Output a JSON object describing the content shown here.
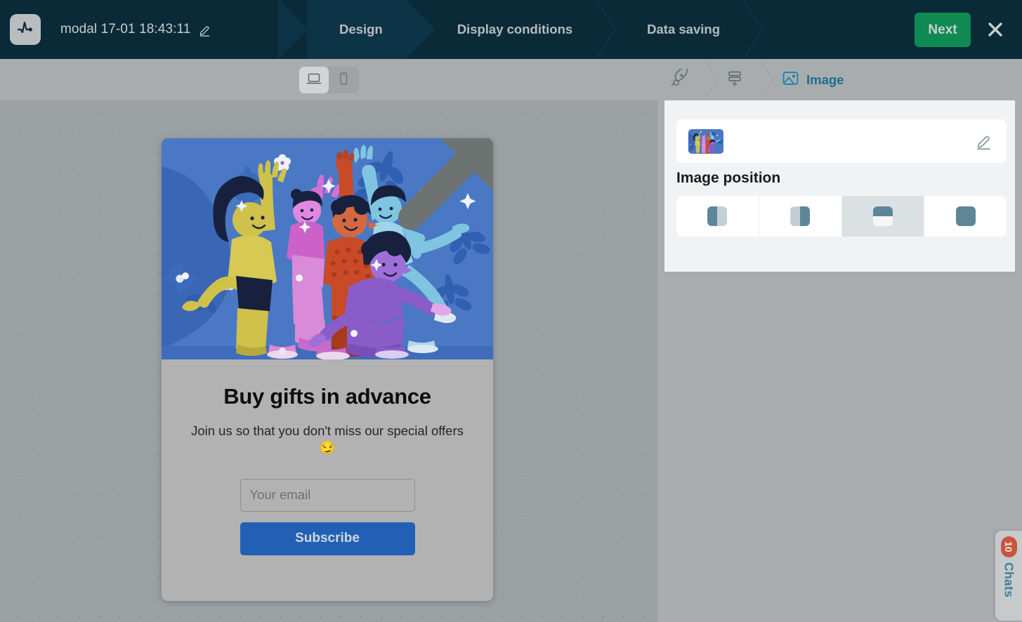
{
  "app": {
    "logo_icon": "pulse-icon",
    "document_title": "modal 17-01 18:43:11",
    "title_edit_icon": "pencil-icon",
    "close_icon": "close-x-icon"
  },
  "steps": [
    {
      "label": "Design",
      "active": true
    },
    {
      "label": "Display conditions",
      "active": false
    },
    {
      "label": "Data saving",
      "active": false
    }
  ],
  "topbar": {
    "next_label": "Next",
    "next_color": "#0f8a53"
  },
  "toolbar": {
    "devices": [
      {
        "name": "desktop-view",
        "icon": "desktop-icon",
        "selected": true
      },
      {
        "name": "mobile-view",
        "icon": "mobile-icon",
        "selected": false
      }
    ]
  },
  "canvas": {
    "background_color": "#9ba0a3",
    "dot_color": "#8c9396"
  },
  "modal_preview": {
    "close_icon": "close-circle-icon",
    "image_alt": "illustration-people-raising-hands",
    "heading": "Buy gifts in advance",
    "subtitle": "Join us so that you don't miss our special offers 😏",
    "email_placeholder": "Your email",
    "email_value": "",
    "subscribe_label": "Subscribe",
    "subscribe_color": "#2160b4"
  },
  "panel": {
    "breadcrumb": [
      {
        "label": "",
        "icon": "rocket-icon",
        "active": false
      },
      {
        "label": "",
        "icon": "blocks-add-icon",
        "active": false
      },
      {
        "label": "Image",
        "icon": "image-icon",
        "active": true
      }
    ],
    "accent_color": "#1d6f8e",
    "image_field": {
      "thumbnail_alt": "illustration-thumbnail",
      "edit_icon": "pencil-icon"
    },
    "position_section_label": "Image position",
    "positions": [
      {
        "name": "image-position-left",
        "icon": "position-left-icon",
        "selected": false
      },
      {
        "name": "image-position-right",
        "icon": "position-right-icon",
        "selected": false
      },
      {
        "name": "image-position-top",
        "icon": "position-top-icon",
        "selected": true
      },
      {
        "name": "image-position-full",
        "icon": "position-full-icon",
        "selected": false
      }
    ]
  },
  "chats_widget": {
    "label": "Chats",
    "badge_count": "10",
    "badge_color": "#c8543f",
    "label_color": "#3c7f96"
  }
}
